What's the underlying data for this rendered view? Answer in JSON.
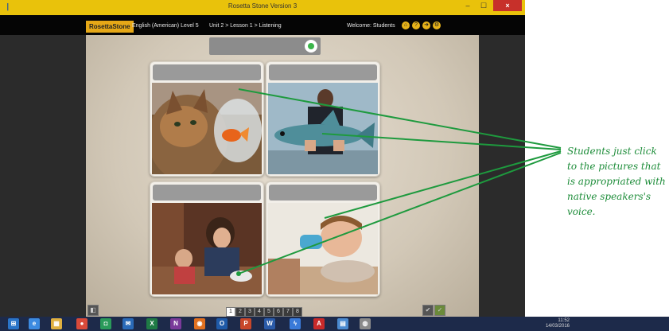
{
  "window": {
    "title": "Rosetta Stone Version 3",
    "app_icon": "rosetta-app-icon",
    "controls": {
      "minimize": "–",
      "maximize": "☐",
      "close": "×"
    }
  },
  "app": {
    "logo": "RosettaStone",
    "course": "English (American) Level 5",
    "breadcrumb": "Unit 2 > Lesson 1 > Listening",
    "welcome": "Welcome: Students",
    "header_icons": [
      "home-icon",
      "help-icon",
      "exit-icon",
      "settings-icon"
    ],
    "accent_color": "#e6a817"
  },
  "progress": {
    "value": 1
  },
  "cards": [
    {
      "name": "cat-and-goldfish",
      "depicts": "cat looking at goldfish bowl"
    },
    {
      "name": "man-holding-fish",
      "depicts": "man holding a large fish"
    },
    {
      "name": "woman-and-baby-eating",
      "depicts": "woman and baby eating at table"
    },
    {
      "name": "boy-drinking",
      "depicts": "boy drinking from a cup"
    }
  ],
  "pager": {
    "pages": [
      "1",
      "2",
      "3",
      "4",
      "5",
      "6",
      "7",
      "8"
    ],
    "current": "1"
  },
  "taskbar": {
    "apps": [
      "start-icon",
      "ie-icon",
      "explorer-icon",
      "chrome-icon",
      "store-icon",
      "mail-icon",
      "excel-icon",
      "onenote-icon",
      "firefox-icon",
      "outlook-icon",
      "powerpoint-icon",
      "word-icon",
      "flash-icon",
      "acrobat-icon",
      "notepad-icon",
      "rosetta-icon"
    ],
    "clock_time": "11:52",
    "clock_date": "14/03/2016"
  },
  "annotation": {
    "text": "Students just click to the pictures that is appropriated with native speakers's voice.",
    "color": "#1e8d3a"
  }
}
